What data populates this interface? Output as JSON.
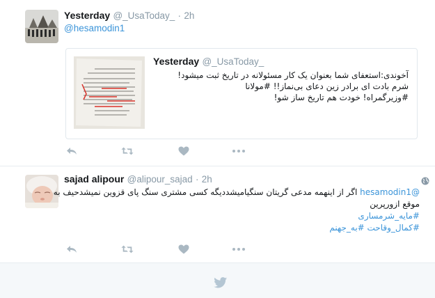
{
  "tweets": [
    {
      "name": "Yesterday",
      "handle": "@_UsaToday_",
      "dot": "·",
      "time": "2h",
      "mention": "@hesamodin1",
      "quote": {
        "name": "Yesterday",
        "handle": "@_UsaToday_",
        "lines": [
          "آخوندی:استعفای شما بعنوان یک کار مسئولانه در تاریخ ثبت میشود!",
          "شرم بادت ای برادر زین دعای بی‌نماز!! #مولانا",
          "#وزیرگمراه! خودت هم تاریخ ساز شو!"
        ]
      }
    },
    {
      "name": "sajad alipour",
      "handle": "@alipour_sajad",
      "dot": "·",
      "time": "2h",
      "line1_mention": "@hesamodin1",
      "line1_text": "اگر از اینهمه مدعی گریتان سنگیامیشددیگه کسی مشتری سنگ پای قزوین نمیشدحیف به",
      "line2": "موقع ازورپرین",
      "hashtag1": "#مایه_شرمساری",
      "hashtag2": "#کمال_وقاحت #به_جهنم"
    }
  ],
  "icons": {
    "reply": "reply-icon",
    "retweet": "retweet-icon",
    "like": "heart-icon",
    "more": "more-icon",
    "globe": "globe-icon",
    "footer": "twitter-bird-icon"
  },
  "colors": {
    "link": "#3b94d9",
    "muted": "#8899a6",
    "action": "#aab8c2",
    "footer_bg": "#f5f8fa"
  }
}
